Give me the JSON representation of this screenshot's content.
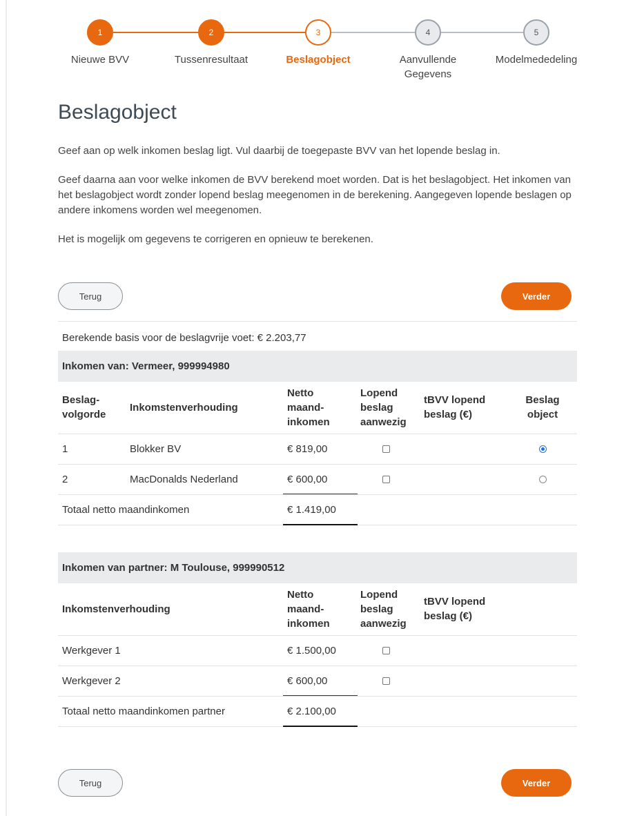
{
  "stepper": {
    "steps": [
      {
        "number": "1",
        "label": "Nieuwe BVV",
        "state": "done"
      },
      {
        "number": "2",
        "label": "Tussenresultaat",
        "state": "done"
      },
      {
        "number": "3",
        "label": "Beslagobject",
        "state": "active"
      },
      {
        "number": "4",
        "label": "Aanvullende Gegevens",
        "state": "todo"
      },
      {
        "number": "5",
        "label": "Modelmededeling",
        "state": "todo"
      }
    ]
  },
  "page_title": "Beslagobject",
  "intro": {
    "p1": "Geef aan op welk inkomen beslag ligt. Vul daarbij de toegepaste BVV van het lopende beslag in.",
    "p2": "Geef daarna aan voor welke inkomen de BVV berekend moet worden. Dat is het beslagobject. Het inkomen van het beslagobject wordt zonder lopend beslag meegenomen in de berekening. Aangegeven lopende beslagen op andere inkomens worden wel meegenomen.",
    "p3": "Het is mogelijk om gegevens te corrigeren en opnieuw te berekenen."
  },
  "buttons": {
    "back": "Terug",
    "next": "Verder"
  },
  "basis": "Berekende basis voor de beslagvrije voet: € 2.203,77",
  "income": {
    "heading": "Inkomen van: Vermeer, 999994980",
    "columns": {
      "order": "Beslag-volgorde",
      "relation": "Inkomstenverhouding",
      "net": "Netto maand-inkomen",
      "attachment": "Lopend beslag aanwezig",
      "tbvv": "tBVV lopend beslag (€)",
      "object": "Beslag object"
    },
    "rows": [
      {
        "order": "1",
        "relation": "Blokker BV",
        "net": "€ 819,00",
        "attachment": false,
        "object": true
      },
      {
        "order": "2",
        "relation": "MacDonalds Nederland",
        "net": "€ 600,00",
        "attachment": false,
        "object": false
      }
    ],
    "total_label": "Totaal netto maandinkomen",
    "total_value": "€ 1.419,00"
  },
  "partner": {
    "heading": "Inkomen van partner: M Toulouse, 999990512",
    "columns": {
      "relation": "Inkomstenverhouding",
      "net": "Netto maand-inkomen",
      "attachment": "Lopend beslag aanwezig",
      "tbvv": "tBVV lopend beslag (€)"
    },
    "rows": [
      {
        "relation": "Werkgever 1",
        "net": "€ 1.500,00",
        "attachment": false
      },
      {
        "relation": "Werkgever 2",
        "net": "€ 600,00",
        "attachment": false
      }
    ],
    "total_label": "Totaal netto maandinkomen partner",
    "total_value": "€ 2.100,00"
  },
  "colors": {
    "accent": "#e8680f",
    "radio_selected": "#1a73e8",
    "section_bg": "#e9ebed"
  }
}
